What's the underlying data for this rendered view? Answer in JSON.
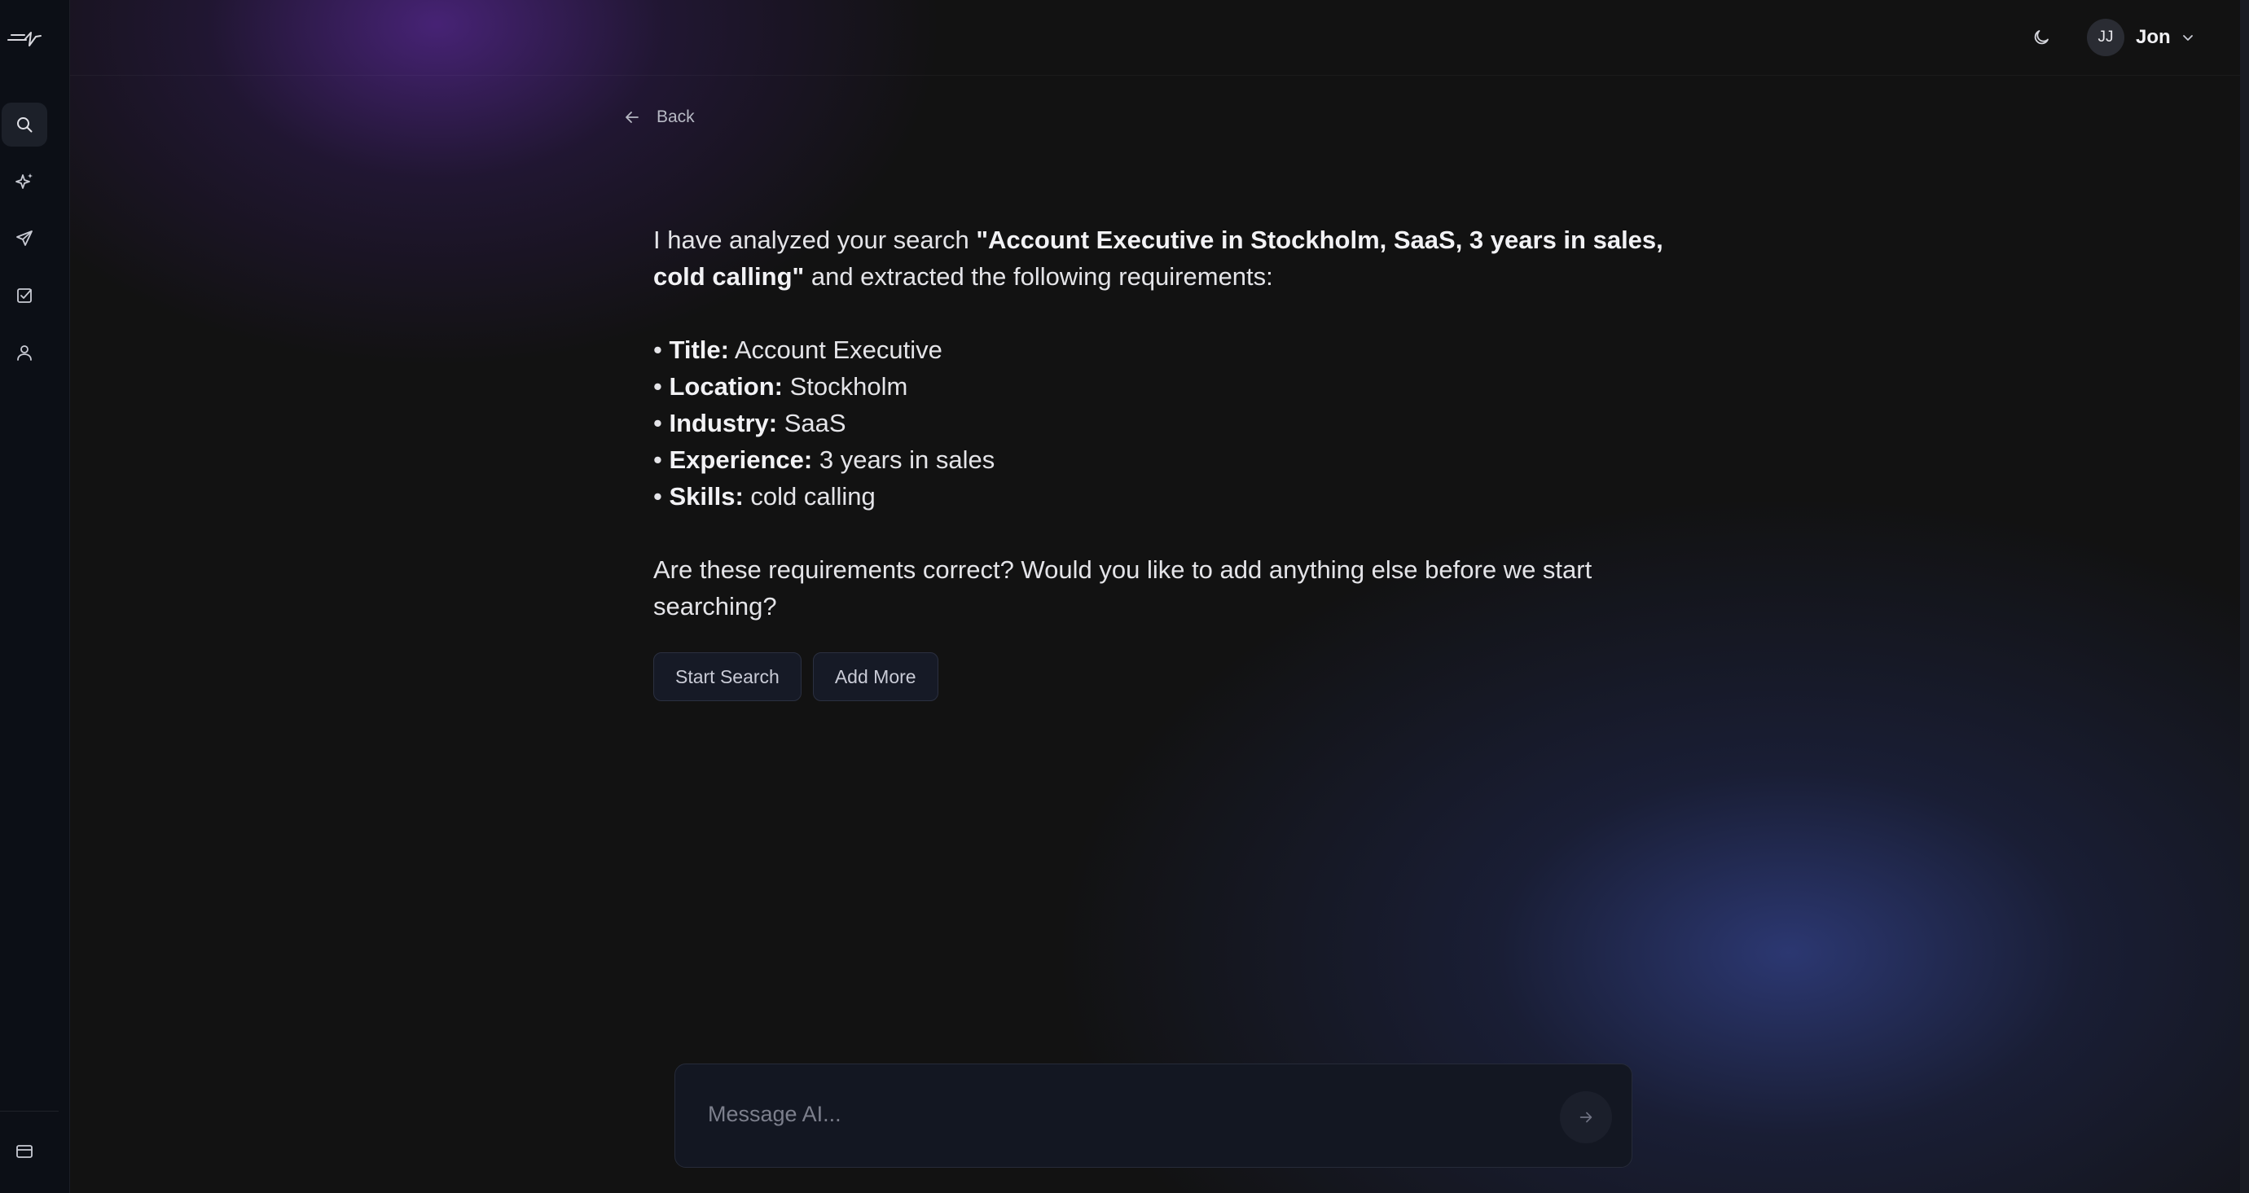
{
  "sidebar": {
    "logo_icon": "brand-logo-icon",
    "items": [
      {
        "name": "search",
        "icon": "search-icon",
        "active": true
      },
      {
        "name": "ai-sparkle",
        "icon": "sparkle-icon",
        "active": false
      },
      {
        "name": "send",
        "icon": "send-icon",
        "active": false
      },
      {
        "name": "tasks",
        "icon": "checkbox-icon",
        "active": false
      },
      {
        "name": "profile",
        "icon": "user-icon",
        "active": false
      }
    ],
    "bottom_icon": "billing-card-icon"
  },
  "header": {
    "theme_icon": "moon-icon",
    "user": {
      "initials": "JJ",
      "name": "Jon"
    }
  },
  "back": {
    "label": "Back"
  },
  "message": {
    "intro_prefix": "I have analyzed your search ",
    "search_query": "\"Account Executive in Stockholm, SaaS, 3 years in sales, cold calling\"",
    "intro_suffix": " and extracted the following requirements:",
    "requirements": [
      {
        "label": "Title:",
        "value": " Account Executive"
      },
      {
        "label": "Location:",
        "value": " Stockholm"
      },
      {
        "label": "Industry:",
        "value": " SaaS"
      },
      {
        "label": "Experience:",
        "value": " 3 years in sales"
      },
      {
        "label": "Skills:",
        "value": " cold calling"
      }
    ],
    "bullet": "• ",
    "question": "Are these requirements correct? Would you like to add anything else before we start searching?"
  },
  "actions": {
    "start_search": "Start Search",
    "add_more": "Add More"
  },
  "composer": {
    "placeholder": "Message AI...",
    "value": ""
  },
  "colors": {
    "background": "#121212",
    "sidebar": "#0c0f16",
    "purple_glow": "#582896",
    "blue_glow": "#303e82"
  }
}
